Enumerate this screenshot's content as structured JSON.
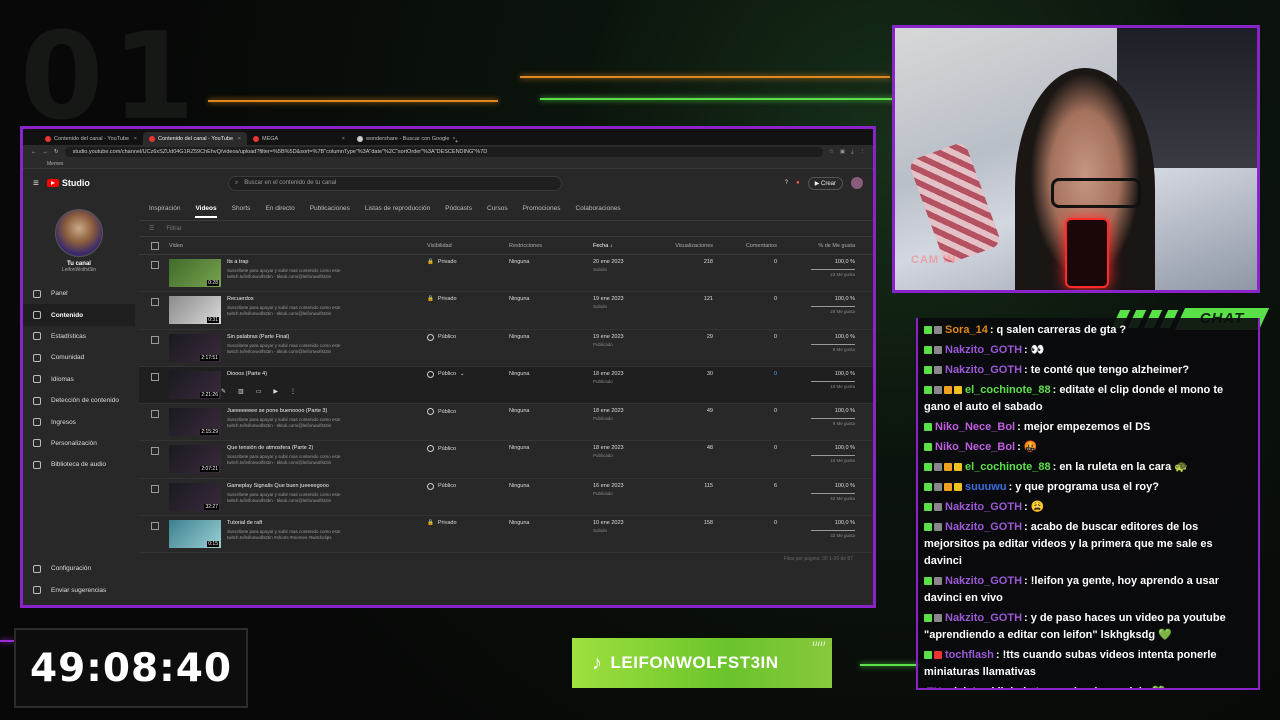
{
  "browser": {
    "tabs": [
      {
        "label": "Contenido del canal - YouTube"
      },
      {
        "label": "Contenido del canal - YouTube"
      },
      {
        "label": "MEGA"
      },
      {
        "label": "wondershare - Buscar con Google"
      }
    ],
    "url": "studio.youtube.com/channel/UCz6xSZUd04G1RZ59ChEhvQ/videos/upload?filter=%5B%5D&sort=%7B\"columnType\"%3A\"date\"%2C\"sortOrder\"%3A\"DESCENDING\"%7D",
    "bookmark": "Memes"
  },
  "studio": {
    "brand": "Studio",
    "search_placeholder": "Buscar en el contenido de tu canal",
    "create_label": "Crear",
    "channel_title": "Tu canal",
    "channel_handle": "LeifonWolfst3in",
    "nav": [
      {
        "label": "Panel",
        "icon": "dashboard-icon"
      },
      {
        "label": "Contenido",
        "icon": "content-icon"
      },
      {
        "label": "Estadísticas",
        "icon": "analytics-icon"
      },
      {
        "label": "Comunidad",
        "icon": "community-icon"
      },
      {
        "label": "Idiomas",
        "icon": "languages-icon"
      },
      {
        "label": "Detección de contenido",
        "icon": "detection-icon"
      },
      {
        "label": "Ingresos",
        "icon": "earn-icon"
      },
      {
        "label": "Personalización",
        "icon": "customization-icon"
      },
      {
        "label": "Biblioteca de audio",
        "icon": "audio-library-icon"
      }
    ],
    "nav_bottom": [
      {
        "label": "Configuración",
        "icon": "gear-icon"
      },
      {
        "label": "Enviar sugerencias",
        "icon": "feedback-icon"
      }
    ],
    "content_tabs": [
      "Inspiración",
      "Videos",
      "Shorts",
      "En directo",
      "Publicaciones",
      "Listas de reproducción",
      "Pódcasts",
      "Cursos",
      "Promociones",
      "Colaboraciones"
    ],
    "filter_placeholder": "Filtrar",
    "columns": {
      "video": "Video",
      "visibility": "Visibilidad",
      "restrictions": "Restricciones",
      "date": "Fecha",
      "views": "Visualizaciones",
      "comments": "Comentarios",
      "likes": "% de Me gusta"
    },
    "rows": [
      {
        "title": "Its a trap",
        "duration": "0:28",
        "desc1": "Suscribete para apoyar y subir mas contenido como este",
        "desc2": "twitch.tv/leifonwolfst3in - tiktok.com/@leifonwolfst3in",
        "visibility": "Privado",
        "restrictions": "Ninguna",
        "date": "20 ene 2023",
        "date_status": "Subido",
        "views": "218",
        "comments": "0",
        "likes_pct": "100,0 %",
        "likes_count": "23 Me gusta",
        "thumb": "green"
      },
      {
        "title": "Recuerdos",
        "duration": "0:31",
        "desc1": "Suscribete para apoyar y subir mas contenido como este",
        "desc2": "twitch.tv/leifonwolfst3in - tiktok.com/@leifonwolfst3in",
        "visibility": "Privado",
        "restrictions": "Ninguna",
        "date": "19 ene 2023",
        "date_status": "Subido",
        "views": "121",
        "comments": "0",
        "likes_pct": "100,0 %",
        "likes_count": "28 Me gusta",
        "thumb": "room"
      },
      {
        "title": "Sin palabras (Parte Final)",
        "duration": "2:17:51",
        "desc1": "Suscribete para apoyar y subir mas contenido como este",
        "desc2": "twitch.tv/leifonwolfst3in - tiktok.com/@leifonwolfst3in",
        "visibility": "Público",
        "restrictions": "Ninguna",
        "date": "19 ene 2023",
        "date_status": "Publicado",
        "views": "29",
        "comments": "0",
        "likes_pct": "100,0 %",
        "likes_count": "8 Me gusta",
        "thumb": "dark"
      },
      {
        "title": "Diooos (Parte 4)",
        "duration": "2:21:26",
        "desc1": "",
        "desc2": "",
        "visibility": "Público",
        "restrictions": "Ninguna",
        "date": "18 ene 2023",
        "date_status": "Publicado",
        "views": "30",
        "comments": "0",
        "likes_pct": "100,0 %",
        "likes_count": "10 Me gusta",
        "thumb": "dark",
        "hover": true
      },
      {
        "title": "Jueeeeeeee se pone buenoooo (Parte 3)",
        "duration": "2:15:29",
        "desc1": "Suscribete para apoyar y subir mas contenido como este",
        "desc2": "twitch.tv/leifonwolfst3in - tiktok.com/@leifonwolfst3in",
        "visibility": "Público",
        "restrictions": "Ninguna",
        "date": "18 ene 2023",
        "date_status": "Publicado",
        "views": "49",
        "comments": "0",
        "likes_pct": "100,0 %",
        "likes_count": "9 Me gusta",
        "thumb": "dark"
      },
      {
        "title": "Que tensión de atmosfera (Parte 2)",
        "duration": "2:07:21",
        "desc1": "Suscribete para apoyar y subir mas contenido como este",
        "desc2": "twitch.tv/leifonwolfst3in - tiktok.com/@leifonwolfst3in",
        "visibility": "Público",
        "restrictions": "Ninguna",
        "date": "18 ene 2023",
        "date_status": "Publicado",
        "views": "48",
        "comments": "0",
        "likes_pct": "100,0 %",
        "likes_count": "15 Me gusta",
        "thumb": "dark"
      },
      {
        "title": "Gameplay Signalis Que buen jueeeegooo",
        "duration": "32:27",
        "desc1": "Suscribete para apoyar y subir mas contenido como este",
        "desc2": "twitch.tv/leifonwolfst3in - tiktok.com/@leifonwolfst3in",
        "visibility": "Público",
        "restrictions": "Ninguna",
        "date": "16 ene 2023",
        "date_status": "Publicado",
        "views": "115",
        "comments": "6",
        "likes_pct": "100,0 %",
        "likes_count": "42 Me gusta",
        "thumb": "dark"
      },
      {
        "title": "Tutorial de raft",
        "duration": "0:15",
        "desc1": "Suscribete para apoyar y subir mas contenido como este",
        "desc2": "twitch.tv/leifonwolfst3in #shorts #memes #twitchclips",
        "visibility": "Privado",
        "restrictions": "Ninguna",
        "date": "10 ene 2023",
        "date_status": "Subido",
        "views": "158",
        "comments": "0",
        "likes_pct": "100,0 %",
        "likes_count": "33 Me gusta",
        "thumb": "raft"
      }
    ],
    "footer": "Filas por página: 30   1-30 de 87"
  },
  "webcam": {
    "watermark": "CAM IN"
  },
  "chat": {
    "tag": "CHAT",
    "messages": [
      {
        "user": "Sora_14",
        "color": "#e0871f",
        "text": ": q salen carreras de gta ?",
        "badges": [
          "#5be04a",
          "#888"
        ]
      },
      {
        "user": "Nakzito_GOTH",
        "color": "#9b59d6",
        "text": ": 👀",
        "badges": [
          "#5be04a",
          "#888"
        ]
      },
      {
        "user": "Nakzito_GOTH",
        "color": "#9b59d6",
        "text": ": te conté que tengo alzheimer?",
        "badges": [
          "#5be04a",
          "#888"
        ]
      },
      {
        "user": "el_cochinote_88",
        "color": "#5be04a",
        "text": ": editate el clip donde el mono te gano el auto el sabado",
        "badges": [
          "#5be04a",
          "#888",
          "#f0a020",
          "#f0c020"
        ]
      },
      {
        "user": "Niko_Nece_Bol",
        "color": "#c05ee0",
        "text": ": mejor empezemos el DS",
        "badges": [
          "#5be04a"
        ]
      },
      {
        "user": "Niko_Nece_Bol",
        "color": "#c05ee0",
        "text": ": 🤬",
        "badges": [
          "#5be04a"
        ]
      },
      {
        "user": "el_cochinote_88",
        "color": "#5be04a",
        "text": ": en la ruleta en la cara 🐢",
        "badges": [
          "#5be04a",
          "#888",
          "#f0a020",
          "#f0c020"
        ]
      },
      {
        "user": "suuuwu",
        "color": "#3b6fe0",
        "text": ": y que programa usa el roy?",
        "badges": [
          "#5be04a",
          "#888",
          "#f0a020",
          "#f0c020"
        ]
      },
      {
        "user": "Nakzito_GOTH",
        "color": "#9b59d6",
        "text": ": 😩",
        "badges": [
          "#5be04a",
          "#888"
        ]
      },
      {
        "user": "Nakzito_GOTH",
        "color": "#9b59d6",
        "text": ": acabo de buscar editores de los mejorsitos pa editar videos y la primera que me sale es davinci",
        "badges": [
          "#5be04a",
          "#888"
        ]
      },
      {
        "user": "Nakzito_GOTH",
        "color": "#9b59d6",
        "text": ": !leifon ya gente, hoy aprendo a usar davinci en vivo",
        "badges": [
          "#5be04a",
          "#888"
        ]
      },
      {
        "user": "Nakzito_GOTH",
        "color": "#9b59d6",
        "text": ": y de paso haces un video pa youtube \"aprendiendo a editar con leifon\" lskhgksdg 💚",
        "badges": [
          "#5be04a",
          "#888"
        ]
      },
      {
        "user": "tochflash",
        "color": "#9b59d6",
        "text": ": !tts cuando subas videos intenta ponerle miniaturas llamativas",
        "badges": [
          "#5be04a",
          "#e33"
        ]
      },
      {
        "user": "TH",
        "color": "#9b59d6",
        "text": ": dejate el link de tu canal acá y anclalo 💚",
        "badges": []
      }
    ]
  },
  "stream": {
    "timer": "49:08:40",
    "tiktok_handle": "LEIFONWOLFST3IN"
  }
}
